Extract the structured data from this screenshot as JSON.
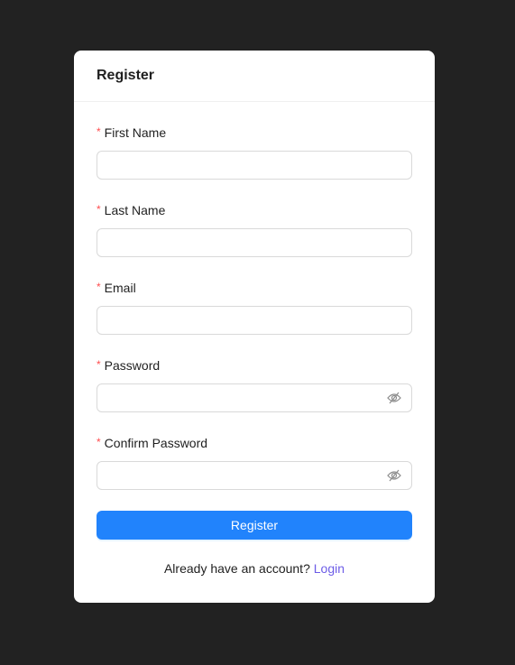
{
  "card": {
    "title": "Register"
  },
  "fields": [
    {
      "label": "First Name",
      "required_mark": "*",
      "value": "",
      "type": "text"
    },
    {
      "label": "Last Name",
      "required_mark": "*",
      "value": "",
      "type": "text"
    },
    {
      "label": "Email",
      "required_mark": "*",
      "value": "",
      "type": "text"
    },
    {
      "label": "Password",
      "required_mark": "*",
      "value": "",
      "type": "password",
      "icon": "eye-invisible-icon"
    },
    {
      "label": "Confirm Password",
      "required_mark": "*",
      "value": "",
      "type": "password",
      "icon": "eye-invisible-icon"
    }
  ],
  "submit": {
    "label": "Register"
  },
  "footer": {
    "text": "Already have an account?",
    "link": "Login"
  },
  "colors": {
    "background": "#222222",
    "primary": "#2183fc",
    "link": "#6c5ce7",
    "required": "#ff4d4f"
  }
}
